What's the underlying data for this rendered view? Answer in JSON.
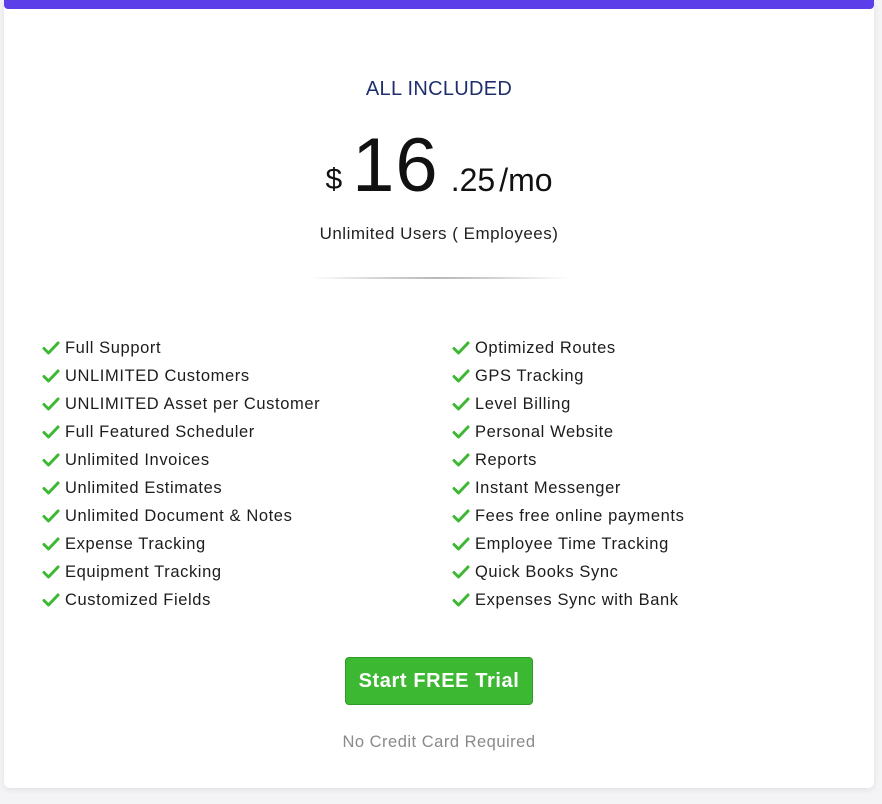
{
  "plan": {
    "title": "ALL INCLUDED",
    "currency": "$",
    "amount": "16",
    "cents": ".25",
    "period": "/mo",
    "subtitle": "Unlimited Users ( Employees)"
  },
  "features": {
    "left": [
      "Full Support",
      "UNLIMITED Customers",
      "UNLIMITED Asset per Customer",
      "Full Featured Scheduler",
      "Unlimited Invoices",
      "Unlimited Estimates",
      "Unlimited Document & Notes",
      "Expense Tracking",
      "Equipment Tracking",
      "Customized Fields"
    ],
    "right": [
      "Optimized Routes",
      "GPS Tracking",
      "Level Billing",
      "Personal Website",
      "Reports",
      "Instant Messenger",
      "Fees free online payments",
      "Employee Time Tracking",
      "Quick Books Sync",
      "Expenses Sync with Bank"
    ]
  },
  "cta": {
    "label": "Start FREE Trial",
    "note": "No Credit Card Required"
  },
  "colors": {
    "accent_bar": "#5b3fe8",
    "check": "#3db833",
    "button": "#3db833",
    "title": "#1f2f6e"
  },
  "icons": {
    "feature_bullet": "check-icon"
  }
}
